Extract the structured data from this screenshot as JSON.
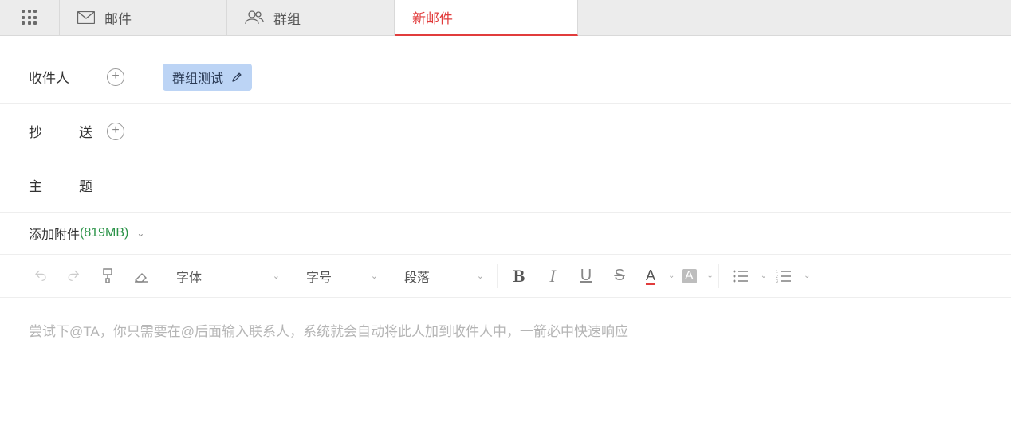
{
  "tabs": {
    "mail": "邮件",
    "groups": "群组",
    "compose": "新邮件"
  },
  "compose": {
    "labels": {
      "to": "收件人",
      "cc_c1": "抄",
      "cc_c2": "送",
      "subj_c1": "主",
      "subj_c2": "题"
    },
    "recipient_chip": "群组测试",
    "subject_value": "",
    "attach_label": "添加附件",
    "attach_size": "(819MB)"
  },
  "toolbar": {
    "font": "字体",
    "size": "字号",
    "para": "段落"
  },
  "body_placeholder": "尝试下@TA，你只需要在@后面输入联系人，系统就会自动将此人加到收件人中，一箭必中快速响应"
}
